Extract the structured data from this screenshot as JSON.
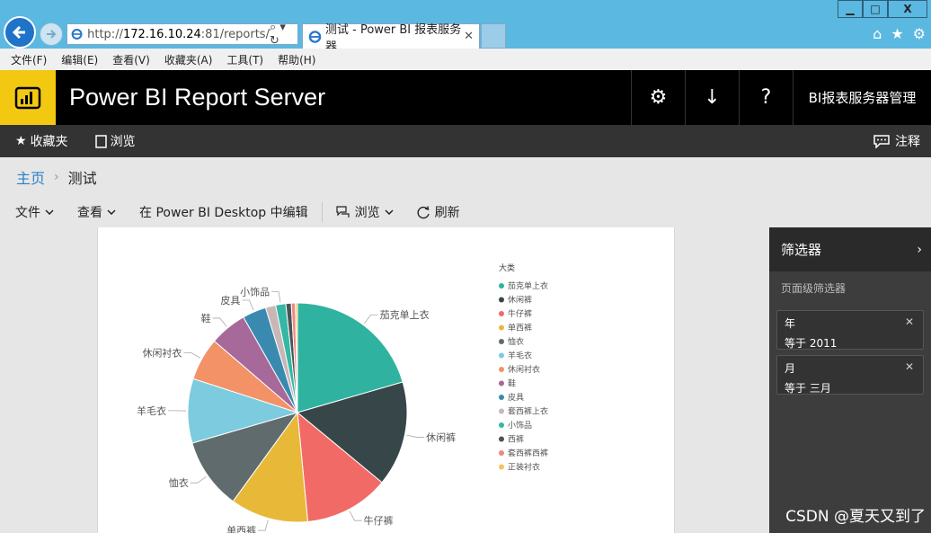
{
  "browser": {
    "url_prefix": "http://",
    "url_host": "172.16.10.24",
    "url_path": ":81/reports/",
    "addr_tools": "⌕ ▾ ↻",
    "tab_title": "测试 - Power BI 报表服务器",
    "tab_close": "✕",
    "win_min": "▁",
    "win_max": "□",
    "win_close": "X",
    "home_icon": "⌂",
    "fav_icon": "★",
    "gear_icon": "⚙",
    "menu": [
      "文件(F)",
      "编辑(E)",
      "查看(V)",
      "收藏夹(A)",
      "工具(T)",
      "帮助(H)"
    ]
  },
  "header": {
    "title": "Power BI Report Server",
    "settings_icon": "⚙",
    "download_icon": "↓",
    "help_icon": "?",
    "admin_label": "BI报表服务器管理"
  },
  "subbar": {
    "favorites": "收藏夹",
    "browse": "浏览",
    "comments": "注释"
  },
  "breadcrumb": {
    "home": "主页",
    "sep": "›",
    "current": "测试"
  },
  "toolbar": {
    "file": "文件",
    "view": "查看",
    "edit": "在 Power BI Desktop 中编辑",
    "browse": "浏览",
    "refresh": "刷新"
  },
  "filters": {
    "title": "筛选器",
    "chevron": "›",
    "section": "页面级筛选器",
    "items": [
      {
        "name": "年",
        "value": "等于 2011",
        "clear": "✕"
      },
      {
        "name": "月",
        "value": "等于 三月",
        "clear": "✕"
      }
    ]
  },
  "watermark": "CSDN @夏天又到了",
  "chart_data": {
    "type": "pie",
    "legend_title": "大类",
    "legend_position": "right",
    "series": [
      {
        "name": "茄克单上衣",
        "value": 20.5,
        "color": "#2fb3a0"
      },
      {
        "name": "休闲裤",
        "value": 15.5,
        "color": "#374649"
      },
      {
        "name": "牛仔裤",
        "value": 12.5,
        "color": "#f26a66"
      },
      {
        "name": "单西裤",
        "value": 11.5,
        "color": "#e8b938"
      },
      {
        "name": "恤衣",
        "value": 10.5,
        "color": "#5f6b6d"
      },
      {
        "name": "羊毛衣",
        "value": 9.5,
        "color": "#7ccbde"
      },
      {
        "name": "休闲衬衣",
        "value": 6.3,
        "color": "#f39167"
      },
      {
        "name": "鞋",
        "value": 5.5,
        "color": "#a66999"
      },
      {
        "name": "皮具",
        "value": 3.5,
        "color": "#3a8ab0"
      },
      {
        "name": "套西裤上衣",
        "value": 1.5,
        "color": "#c9b6b6"
      },
      {
        "name": "小饰品",
        "value": 1.5,
        "color": "#35b7a4"
      },
      {
        "name": "西裤",
        "value": 0.8,
        "color": "#4a5456"
      },
      {
        "name": "套西裤西裤",
        "value": 0.6,
        "color": "#f08784"
      },
      {
        "name": "正装衬衣",
        "value": 0.3,
        "color": "#f0c75a"
      }
    ],
    "visible_slice_labels": [
      "茄克单上衣",
      "休闲裤",
      "牛仔裤",
      "单西裤",
      "恤衣",
      "羊毛衣",
      "休闲衬衣",
      "鞋",
      "皮具",
      "小饰品"
    ]
  }
}
